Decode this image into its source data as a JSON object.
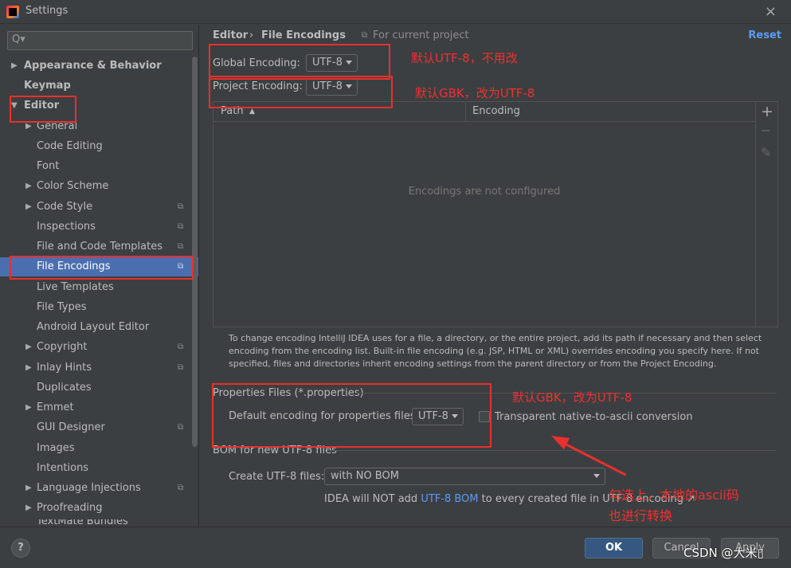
{
  "window": {
    "title": "Settings",
    "close_icon": "×"
  },
  "search": {
    "placeholder": "",
    "icon": "Q▾"
  },
  "sidebar": {
    "items": [
      {
        "label": "Appearance & Behavior",
        "arrow": "▶"
      },
      {
        "label": "Keymap"
      },
      {
        "label": "Editor",
        "arrow": "▼"
      },
      {
        "label": "General",
        "arrow": "▶"
      },
      {
        "label": "Code Editing"
      },
      {
        "label": "Font"
      },
      {
        "label": "Color Scheme",
        "arrow": "▶"
      },
      {
        "label": "Code Style",
        "arrow": "▶",
        "project_icon": "⧉"
      },
      {
        "label": "Inspections",
        "project_icon": "⧉"
      },
      {
        "label": "File and Code Templates",
        "project_icon": "⧉"
      },
      {
        "label": "File Encodings",
        "project_icon": "⧉",
        "selected": true
      },
      {
        "label": "Live Templates"
      },
      {
        "label": "File Types"
      },
      {
        "label": "Android Layout Editor"
      },
      {
        "label": "Copyright",
        "arrow": "▶",
        "project_icon": "⧉"
      },
      {
        "label": "Inlay Hints",
        "arrow": "▶",
        "project_icon": "⧉"
      },
      {
        "label": "Duplicates"
      },
      {
        "label": "Emmet",
        "arrow": "▶"
      },
      {
        "label": "GUI Designer",
        "project_icon": "⧉"
      },
      {
        "label": "Images"
      },
      {
        "label": "Intentions"
      },
      {
        "label": "Language Injections",
        "arrow": "▶",
        "project_icon": "⧉"
      },
      {
        "label": "Proofreading",
        "arrow": "▶"
      },
      {
        "label": "TextMate Bundles"
      }
    ]
  },
  "header": {
    "breadcrumb_parent": "Editor",
    "breadcrumb_sep": "›",
    "breadcrumb_current": "File Encodings",
    "for_project_icon": "⧉",
    "for_project": "For current project",
    "reset": "Reset"
  },
  "encodings": {
    "global_label": "Global Encoding:",
    "global_value": "UTF-8",
    "project_label": "Project Encoding:",
    "project_value": "UTF-8"
  },
  "table": {
    "col_path": "Path",
    "sort_icon": "▲",
    "col_encoding": "Encoding",
    "empty": "Encodings are not configured",
    "add_icon": "+",
    "remove_icon": "−",
    "edit_icon": "✎"
  },
  "help_text": "To change encoding IntelliJ IDEA uses for a file, a directory, or the entire project, add its path if necessary and then select encoding from the encoding list. Built-in file encoding (e.g. JSP, HTML or XML) overrides encoding you specify here. If not specified, files and directories inherit encoding settings from the parent directory or from the Project Encoding.",
  "properties": {
    "title": "Properties Files (*.properties)",
    "default_label": "Default encoding for properties files:",
    "default_value": "UTF-8",
    "native_ascii_label": "Transparent native-to-ascii conversion"
  },
  "bom": {
    "title": "BOM for new UTF-8 files",
    "create_label": "Create UTF-8 files:",
    "create_value": "with NO BOM",
    "note_prefix": "IDEA will NOT add ",
    "note_link": "UTF-8 BOM",
    "note_suffix": " to every created file in UTF-8 encoding ↗"
  },
  "footer": {
    "help": "?",
    "ok": "OK",
    "cancel": "Cancel",
    "apply": "Apply",
    "watermark": "CSDN @大米▯"
  },
  "annotations": {
    "global": "默认UTF-8，不用改",
    "project": "默认GBK，改为UTF-8",
    "properties": "默认GBK，改为UTF-8",
    "checkbox_line1": "勾选上，本地的ascii码",
    "checkbox_line2": "也进行转换"
  },
  "colors": {
    "background": "#3c3f41",
    "selection": "#4b6eaf",
    "link": "#589df6",
    "annotation": "#e8302f"
  }
}
